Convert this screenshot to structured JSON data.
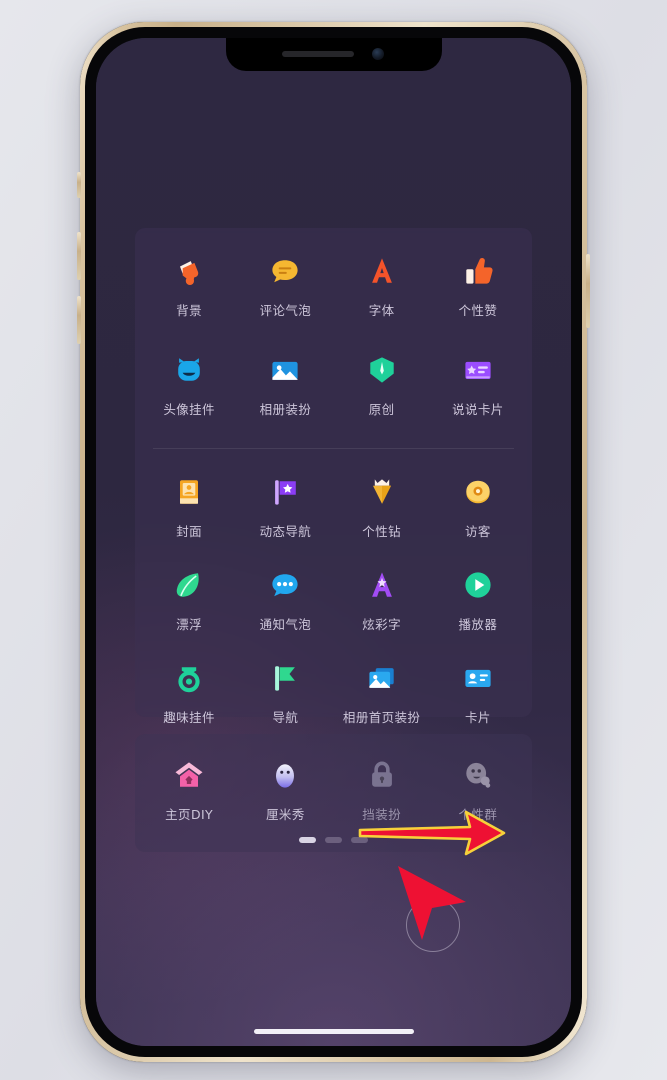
{
  "device": {
    "name": "iphone-12-gold",
    "frame_color": "#e0cfa9",
    "screen_bg": "#2e2841"
  },
  "screen": {
    "panel_bg": "#3c3252",
    "label_color": "#cdc6da",
    "dim_label_color": "#9c94ad"
  },
  "main_panel": {
    "rows": [
      [
        {
          "label": "背景",
          "icon": "megaphone-icon",
          "color": "#f4642a",
          "dim": false
        },
        {
          "label": "评论气泡",
          "icon": "chat-bubble-icon",
          "color": "#f5b731",
          "dim": false
        },
        {
          "label": "字体",
          "icon": "letter-a-icon",
          "color": "#f4532a",
          "dim": false
        },
        {
          "label": "个性赞",
          "icon": "thumbs-up-icon",
          "color": "#f4642a",
          "dim": false
        }
      ],
      [
        {
          "label": "头像挂件",
          "icon": "avatar-pendant-icon",
          "color": "#1aa6e8",
          "dim": false
        },
        {
          "label": "相册装扮",
          "icon": "photo-album-icon",
          "color": "#1f93e0",
          "dim": false
        },
        {
          "label": "原创",
          "icon": "gem-pen-icon",
          "color": "#1fd19a",
          "dim": false
        },
        {
          "label": "说说卡片",
          "icon": "post-card-icon",
          "color": "#9b4dff",
          "dim": false
        }
      ],
      [
        {
          "label": "封面",
          "icon": "cover-book-icon",
          "color": "#f5a623",
          "dim": false
        },
        {
          "label": "动态导航",
          "icon": "flag-star-icon",
          "color": "#8b3df5",
          "dim": false
        },
        {
          "label": "个性钻",
          "icon": "crown-diamond-icon",
          "color": "#f2b434",
          "dim": false
        },
        {
          "label": "访客",
          "icon": "visitor-ring-icon",
          "color": "#f5b731",
          "dim": false
        }
      ],
      [
        {
          "label": "漂浮",
          "icon": "leaf-icon",
          "color": "#2fd88f",
          "dim": false
        },
        {
          "label": "通知气泡",
          "icon": "notify-bubble-icon",
          "color": "#21a7ef",
          "dim": false
        },
        {
          "label": "炫彩字",
          "icon": "colorful-a-icon",
          "color": "#a24cf5",
          "dim": false
        },
        {
          "label": "播放器",
          "icon": "play-circle-icon",
          "color": "#1fd19a",
          "dim": false
        }
      ],
      [
        {
          "label": "趣味挂件",
          "icon": "fun-pendant-icon",
          "color": "#1fd19a",
          "dim": false
        },
        {
          "label": "导航",
          "icon": "green-flag-icon",
          "color": "#2fd88f",
          "dim": false
        },
        {
          "label": "相册首页装扮",
          "icon": "album-home-icon",
          "color": "#2aa8ef",
          "dim": false
        },
        {
          "label": "卡片",
          "icon": "id-card-icon",
          "color": "#2aa8ef",
          "dim": false
        }
      ]
    ]
  },
  "bottom_panel": {
    "items": [
      {
        "label": "主页DIY",
        "icon": "home-diy-icon",
        "color": "#f461a8",
        "dim": false
      },
      {
        "label": "厘米秀",
        "icon": "cmshow-icon",
        "color": "#8f8ef0",
        "dim": false
      },
      {
        "label": "挡装扮",
        "icon": "lock-icon",
        "color": "#7a7390",
        "dim": true
      },
      {
        "label": "个性群",
        "icon": "penguin-icon",
        "color": "#7a7390",
        "dim": true
      }
    ],
    "page_dots": {
      "count": 3,
      "active_index": 0
    }
  },
  "overlays": {
    "assistive_touch": "assistive-touch-button",
    "touch_ring": "touch-point-indicator",
    "arrow_horizontal": "red-arrow-pointing-right",
    "arrow_cursor": "red-cursor-arrow"
  }
}
